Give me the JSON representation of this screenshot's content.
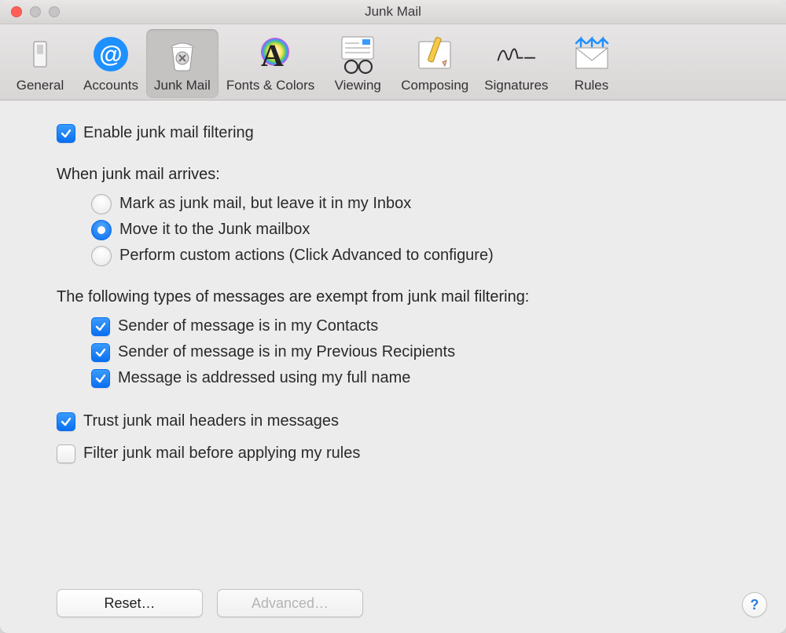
{
  "window": {
    "title": "Junk Mail"
  },
  "toolbar": {
    "items": [
      {
        "id": "general",
        "label": "General",
        "icon": "switch-icon",
        "selected": false
      },
      {
        "id": "accounts",
        "label": "Accounts",
        "icon": "at-icon",
        "selected": false
      },
      {
        "id": "junk",
        "label": "Junk Mail",
        "icon": "trash-icon",
        "selected": true
      },
      {
        "id": "fonts",
        "label": "Fonts & Colors",
        "icon": "fonts-icon",
        "selected": false
      },
      {
        "id": "viewing",
        "label": "Viewing",
        "icon": "glasses-icon",
        "selected": false
      },
      {
        "id": "composing",
        "label": "Composing",
        "icon": "pencil-icon",
        "selected": false
      },
      {
        "id": "signatures",
        "label": "Signatures",
        "icon": "signature-icon",
        "selected": false
      },
      {
        "id": "rules",
        "label": "Rules",
        "icon": "rules-icon",
        "selected": false
      }
    ]
  },
  "main": {
    "enable_filtering": {
      "label": "Enable junk mail filtering",
      "checked": true
    },
    "arrives_heading": "When junk mail arrives:",
    "arrives_options": [
      {
        "id": "mark",
        "label": "Mark as junk mail, but leave it in my Inbox",
        "selected": false
      },
      {
        "id": "move",
        "label": "Move it to the Junk mailbox",
        "selected": true
      },
      {
        "id": "custom",
        "label": "Perform custom actions (Click Advanced to configure)",
        "selected": false
      }
    ],
    "exempt_heading": "The following types of messages are exempt from junk mail filtering:",
    "exempt_options": [
      {
        "id": "contacts",
        "label": "Sender of message is in my Contacts",
        "checked": true
      },
      {
        "id": "previous",
        "label": "Sender of message is in my Previous Recipients",
        "checked": true
      },
      {
        "id": "fullname",
        "label": "Message is addressed using my full name",
        "checked": true
      }
    ],
    "trust_headers": {
      "label": "Trust junk mail headers in messages",
      "checked": true
    },
    "filter_before": {
      "label": "Filter junk mail before applying my rules",
      "checked": false
    }
  },
  "footer": {
    "reset_label": "Reset…",
    "advanced_label": "Advanced…",
    "advanced_enabled": false,
    "help_label": "?"
  }
}
